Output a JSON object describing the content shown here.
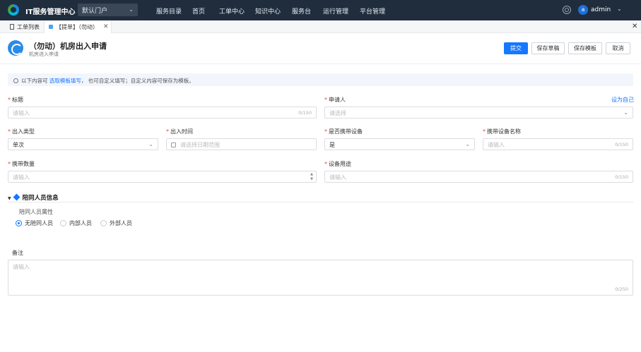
{
  "topbar": {
    "app_title": "IT服务管理中心",
    "portal": "默认门户",
    "nav": [
      "服务目录",
      "首页",
      "工单中心",
      "知识中心",
      "服务台",
      "运行管理",
      "平台管理"
    ],
    "avatar_letter": "a",
    "user": "admin"
  },
  "tabs": [
    {
      "label": "工单列表"
    },
    {
      "label": "【提单】（勿动）"
    }
  ],
  "header": {
    "title": "（勿动）机房出入申请",
    "subtitle": "机房进入申请",
    "buttons": {
      "submit": "提交",
      "draft": "保存草稿",
      "template": "保存模板",
      "cancel": "取消"
    }
  },
  "info": {
    "prefix": "以下内容可",
    "link": "选取模板填写",
    "suffix": "， 也可自定义填写；自定义内容可保存为模板。"
  },
  "fields": {
    "title": {
      "label": "标题",
      "placeholder": "请输入",
      "count": "0/150"
    },
    "applicant": {
      "label": "申请人",
      "placeholder": "请选择",
      "set_self": "设为自己"
    },
    "entry_type": {
      "label": "出入类型",
      "value": "单次"
    },
    "entry_time": {
      "label": "出入时间",
      "placeholder": "请选择日期范围"
    },
    "carry_device": {
      "label": "是否携带设备",
      "value": "是"
    },
    "device_name": {
      "label": "携带设备名称",
      "placeholder": "请输入",
      "count": "0/150"
    },
    "carry_qty": {
      "label": "携带数量",
      "placeholder": "请输入"
    },
    "device_use": {
      "label": "设备用途",
      "placeholder": "请输入",
      "count": "0/150"
    }
  },
  "section": {
    "title": "陪同人员信息",
    "attr_label": "陪同人员属性",
    "options": [
      "无陪同人员",
      "内部人员",
      "外部人员"
    ],
    "selected": "无陪同人员"
  },
  "remark": {
    "label": "备注",
    "placeholder": "请输入",
    "count": "0/250"
  }
}
